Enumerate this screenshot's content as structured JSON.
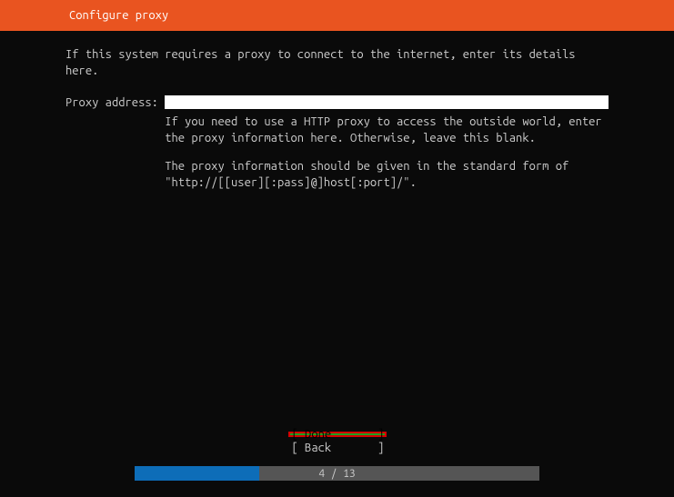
{
  "header": {
    "title": "Configure proxy"
  },
  "intro": "If this system requires a proxy to connect to the internet, enter its details here.",
  "form": {
    "proxy_label": "Proxy address: ",
    "proxy_value": "",
    "help1": "If you need to use a HTTP proxy to access the outside world, enter the proxy information here. Otherwise, leave this blank.",
    "help2": "The proxy information should be given in the standard form of \"http://[[user][:pass]@]host[:port]/\"."
  },
  "buttons": {
    "done": "[ Done       ]",
    "back": "[ Back       ]"
  },
  "progress": {
    "current": 4,
    "total": 13,
    "label": "4 / 13",
    "percent": 30.8
  },
  "colors": {
    "accent": "#e95420",
    "highlight_green": "#1fa01f",
    "highlight_border": "#d40000",
    "progress_fill": "#0d6db8",
    "progress_bg": "#555555"
  }
}
